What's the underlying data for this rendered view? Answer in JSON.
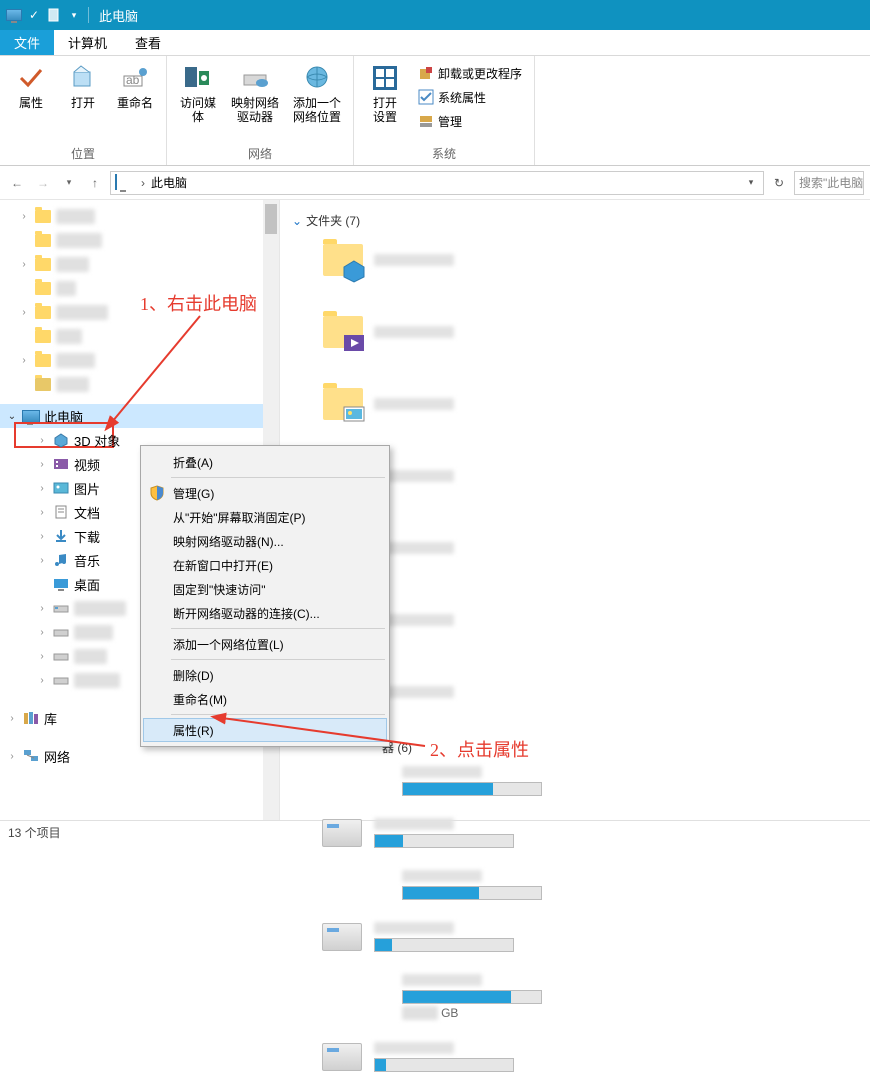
{
  "titlebar": {
    "title": "此电脑"
  },
  "tabs": {
    "file": "文件",
    "computer": "计算机",
    "view": "查看"
  },
  "ribbon": {
    "group_location": {
      "label": "位置",
      "properties": "属性",
      "open": "打开",
      "rename": "重命名"
    },
    "group_network": {
      "label": "网络",
      "media": "访问媒体",
      "mapdrive": "映射网络\n驱动器",
      "addloc": "添加一个\n网络位置"
    },
    "group_system": {
      "label": "系统",
      "opensettings": "打开\n设置",
      "uninstall": "卸载或更改程序",
      "sysprops": "系统属性",
      "manage": "管理"
    }
  },
  "breadcrumb": {
    "location": "此电脑"
  },
  "search": {
    "placeholder": "搜索\"此电脑"
  },
  "tree": {
    "thispc": "此电脑",
    "d3": "3D 对象",
    "video": "视频",
    "pictures": "图片",
    "documents": "文档",
    "downloads": "下载",
    "music": "音乐",
    "desktop": "桌面",
    "library": "库",
    "network": "网络"
  },
  "sections": {
    "folders": "文件夹 (7)",
    "drives_suffix": "器 (6)"
  },
  "drive_label_suffix": "GB",
  "ctx": {
    "collapse": "折叠(A)",
    "manage": "管理(G)",
    "unpin_start": "从\"开始\"屏幕取消固定(P)",
    "mapdrive": "映射网络驱动器(N)...",
    "newwindow": "在新窗口中打开(E)",
    "pin_quick": "固定到\"快速访问\"",
    "disconnect": "断开网络驱动器的连接(C)...",
    "addloc": "添加一个网络位置(L)",
    "delete": "删除(D)",
    "rename": "重命名(M)",
    "properties": "属性(R)"
  },
  "anno": {
    "step1": "1、右击此电脑",
    "step2": "2、点击属性"
  },
  "status": {
    "items": "13 个项目"
  }
}
